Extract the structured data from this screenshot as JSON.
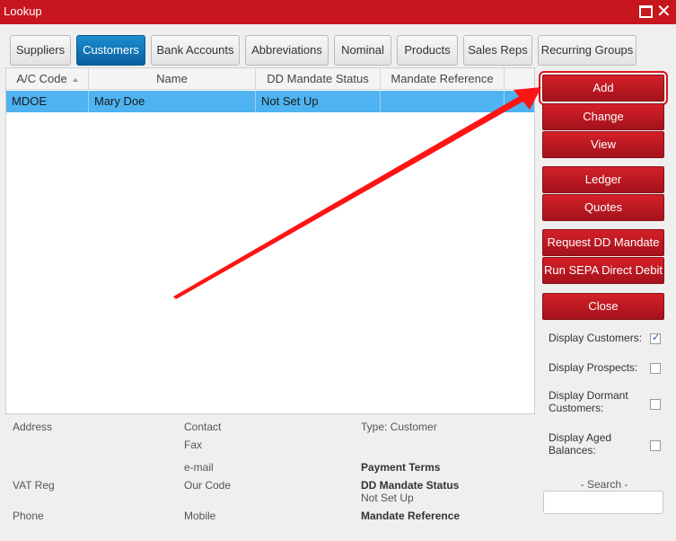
{
  "window": {
    "title": "Lookup"
  },
  "tabs": [
    {
      "label": "Suppliers",
      "active": false
    },
    {
      "label": "Customers",
      "active": true
    },
    {
      "label": "Bank Accounts",
      "active": false
    },
    {
      "label": "Abbreviations",
      "active": false
    },
    {
      "label": "Nominal",
      "active": false
    },
    {
      "label": "Products",
      "active": false
    },
    {
      "label": "Sales Reps",
      "active": false
    },
    {
      "label": "Recurring Groups",
      "active": false
    }
  ],
  "grid": {
    "columns": [
      "A/C Code",
      "Name",
      "DD Mandate Status",
      "Mandate Reference"
    ],
    "rows": [
      {
        "code": "MDOE",
        "name": "Mary Doe",
        "dd_status": "Not Set Up",
        "mandate_ref": "",
        "selected": true
      }
    ]
  },
  "details": {
    "address": "Address",
    "contact": "Contact",
    "fax": "Fax",
    "email": "e-mail",
    "vat_reg": "VAT Reg",
    "our_code": "Our Code",
    "phone": "Phone",
    "mobile": "Mobile",
    "type": "Type: Customer",
    "payment_terms": "Payment Terms",
    "dd_mandate_status_label": "DD Mandate Status",
    "dd_mandate_status_value": "Not Set Up",
    "mandate_reference": "Mandate Reference"
  },
  "actions": {
    "add": "Add",
    "change": "Change",
    "view": "View",
    "ledger": "Ledger",
    "quotes": "Quotes",
    "request_dd": "Request DD Mandate",
    "run_sepa": "Run SEPA Direct Debit",
    "close": "Close"
  },
  "options": [
    {
      "label": "Display Customers:",
      "checked": true
    },
    {
      "label": "Display Prospects:",
      "checked": false
    },
    {
      "label": "Display Dormant Customers:",
      "checked": false
    },
    {
      "label": "Display Aged Balances:",
      "checked": false
    }
  ],
  "search": {
    "label": "- Search -",
    "value": ""
  },
  "colors": {
    "title_bar": "#c8161e",
    "button_red": "#b5161f",
    "tab_active": "#0f74b8",
    "row_selected": "#4eb3f0",
    "annotation_arrow": "#ff1010"
  },
  "icons": {
    "maximize": "maximize-icon",
    "close": "close-icon",
    "sort": "sort-asc-icon",
    "check": "checkmark-icon"
  }
}
